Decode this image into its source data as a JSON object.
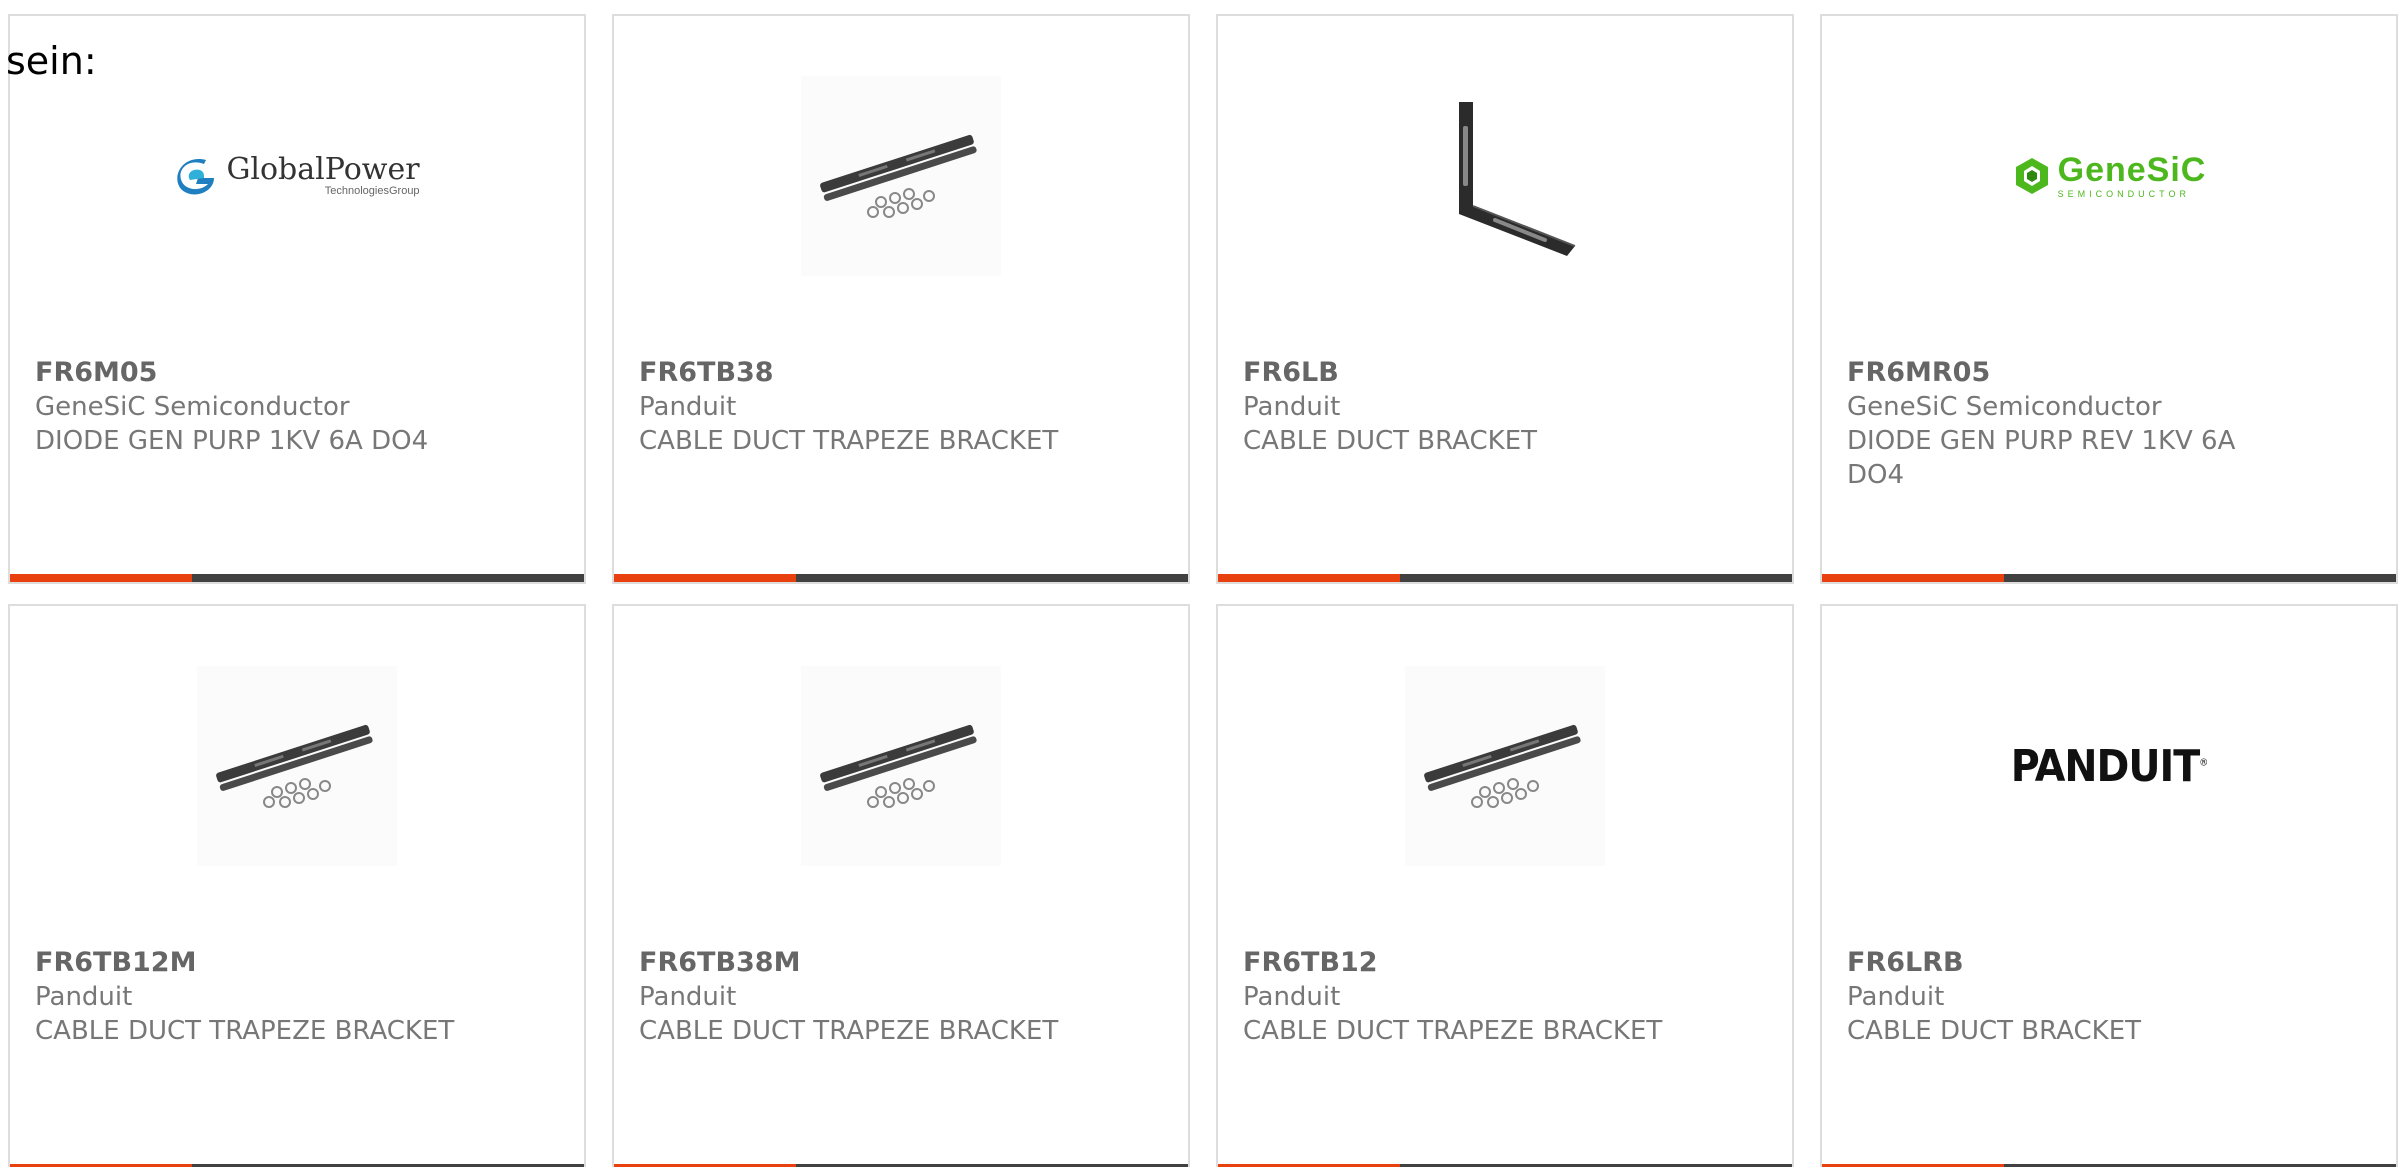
{
  "intro": "sein:",
  "colors": {
    "accent": "#e8400e",
    "bar": "#414141",
    "text": "#777777",
    "border": "#dddddd",
    "genesic_green": "#4db81e"
  },
  "products": [
    {
      "part": "FR6M05",
      "manufacturer": "GeneSiC Semiconductor",
      "description": "DIODE GEN PURP 1KV 6A DO4",
      "image": "globalpower-logo",
      "logo_text": "GlobalPower",
      "logo_sub": "TechnologiesGroup"
    },
    {
      "part": "FR6TB38",
      "manufacturer": "Panduit",
      "description": "CABLE DUCT TRAPEZE BRACKET",
      "image": "trapeze-bracket-photo"
    },
    {
      "part": "FR6LB",
      "manufacturer": "Panduit",
      "description": "CABLE DUCT BRACKET",
      "image": "l-bracket-photo"
    },
    {
      "part": "FR6MR05",
      "manufacturer": "GeneSiC Semiconductor",
      "description": "DIODE GEN PURP REV 1KV 6A DO4",
      "image": "genesic-logo",
      "logo_text": "GeneSiC",
      "logo_sub": "SEMICONDUCTOR"
    },
    {
      "part": "FR6TB12M",
      "manufacturer": "Panduit",
      "description": "CABLE DUCT TRAPEZE BRACKET",
      "image": "trapeze-bracket-photo"
    },
    {
      "part": "FR6TB38M",
      "manufacturer": "Panduit",
      "description": "CABLE DUCT TRAPEZE BRACKET",
      "image": "trapeze-bracket-photo"
    },
    {
      "part": "FR6TB12",
      "manufacturer": "Panduit",
      "description": "CABLE DUCT TRAPEZE BRACKET",
      "image": "trapeze-bracket-photo"
    },
    {
      "part": "FR6LRB",
      "manufacturer": "Panduit",
      "description": "CABLE DUCT BRACKET",
      "image": "panduit-logo",
      "logo_text": "PANDUIT"
    }
  ]
}
